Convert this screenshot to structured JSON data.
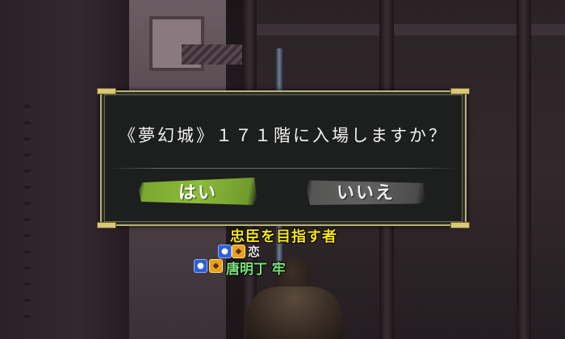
{
  "dialog": {
    "message": "《夢幻城》１７１階に入場しますか？",
    "yes_label": "はい",
    "no_label": "いいえ"
  },
  "name_tags": {
    "line1": "忠臣を目指す者",
    "line2": "恋",
    "line3": "唐明丁 牢"
  },
  "colors": {
    "yes_button": "#8bbb3a",
    "no_button": "#616160",
    "dialog_bg": "#1c1f1d",
    "dialog_border": "#b9b27a",
    "name_yellow": "#f4e51a",
    "name_green": "#7be27a"
  }
}
